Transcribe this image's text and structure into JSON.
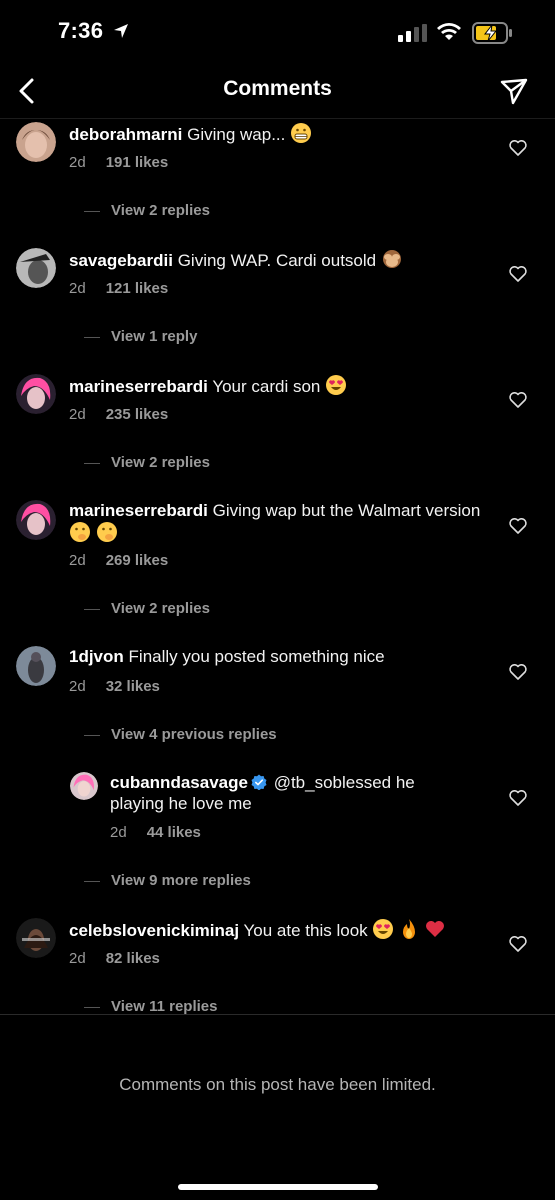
{
  "status": {
    "time": "7:36",
    "icons": [
      "location-arrow-icon",
      "signal-icon",
      "wifi-icon",
      "battery-charging-icon"
    ],
    "battery_color": "#f5c518"
  },
  "header": {
    "title": "Comments",
    "back_icon": "chevron-left-icon",
    "share_icon": "paper-plane-icon"
  },
  "comments": [
    {
      "username": "deborahmarni",
      "text": "Giving wap...",
      "emoji": [
        "grimace"
      ],
      "age": "2d",
      "likes": "191 likes",
      "replies": "View 2 replies"
    },
    {
      "username": "savagebardii",
      "text": "Giving WAP. Cardi outsold",
      "emoji": [
        "see-no-evil-monkey"
      ],
      "age": "2d",
      "likes": "121 likes",
      "replies": "View 1 reply"
    },
    {
      "username": "marineserrebardi",
      "text": "Your cardi son",
      "emoji": [
        "heart-eyes"
      ],
      "age": "2d",
      "likes": "235 likes",
      "replies": "View 2 replies"
    },
    {
      "username": "marineserrebardi",
      "text": "Giving wap but the Walmart version",
      "emoji": [
        "shushing",
        "shushing"
      ],
      "age": "2d",
      "likes": "269 likes",
      "replies": "View 2 replies"
    },
    {
      "username": "1djvon",
      "text": "Finally you posted something nice",
      "emoji": [],
      "age": "2d",
      "likes": "32 likes",
      "replies": "View 4 previous replies"
    },
    {
      "username": "cubanndasavage",
      "verified": true,
      "text": "@tb_soblessed he playing he love me",
      "emoji": [],
      "age": "2d",
      "likes": "44 likes",
      "replies": "View 9 more replies",
      "is_reply": true
    },
    {
      "username": "celebslovenickiminaj",
      "text": "You ate this look",
      "emoji": [
        "heart-eyes",
        "fire",
        "red-heart"
      ],
      "age": "2d",
      "likes": "82 likes",
      "replies": "View 11 replies"
    }
  ],
  "footer": {
    "limited_note": "Comments on this post have been limited."
  },
  "colors": {
    "background": "#000000",
    "secondary_text": "#9a9a9a",
    "verified_blue": "#3897f0"
  }
}
